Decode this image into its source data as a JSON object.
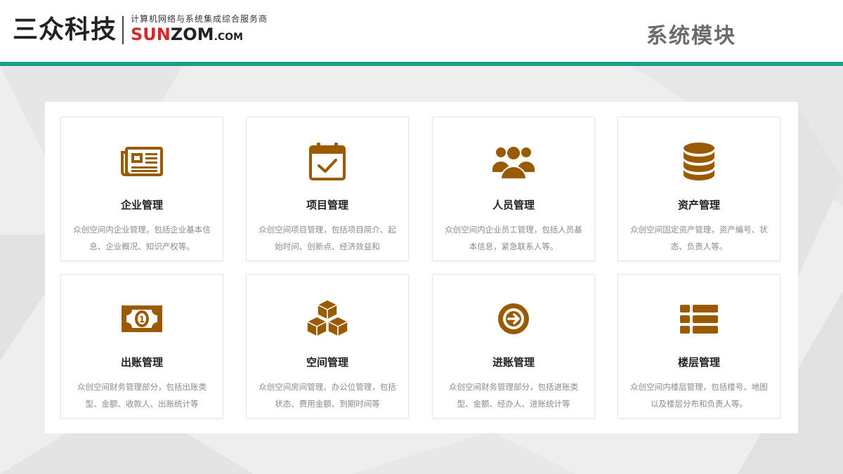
{
  "header": {
    "brand": "三众科技",
    "tagline": "计算机网络与系统集成综合服务商",
    "url_main_red": "SUN",
    "url_main_dark": "ZOM",
    "url_suffix": ".COM",
    "page_title": "系统模块"
  },
  "colors": {
    "accent": "#1f9e86",
    "icon": "#9a5a00",
    "brand_red": "#d22a2a"
  },
  "modules": [
    {
      "icon": "newspaper-icon",
      "title": "企业管理",
      "desc": "众创空间内企业管理，包括企业基本信息、企业概况、知识产权等。"
    },
    {
      "icon": "calendar-check-icon",
      "title": "项目管理",
      "desc": "众创空间项目管理，包括项目简介、起始时间、创新点、经济效益和"
    },
    {
      "icon": "users-icon",
      "title": "人员管理",
      "desc": "众创空间内企业员工管理，包括人员基本信息，紧急联系人等。"
    },
    {
      "icon": "database-icon",
      "title": "资产管理",
      "desc": "众创空间固定资产管理，资产编号、状态、负责人等。"
    },
    {
      "icon": "money-icon",
      "title": "出账管理",
      "desc": "众创空间财务管理部分，包括出账类型、金额、收款人、出账统计等"
    },
    {
      "icon": "cubes-icon",
      "title": "空间管理",
      "desc": "众创空间房间管理、办公位管理，包括状态、费用金额、到期时间等"
    },
    {
      "icon": "arrow-circle-right-icon",
      "title": "进账管理",
      "desc": "众创空间财务管理部分，包括进账类型、金额、经办人、进账统计等"
    },
    {
      "icon": "list-icon",
      "title": "楼层管理",
      "desc": "众创空间内楼层管理，包括楼号、地图以及楼层分布和负责人等。"
    }
  ]
}
